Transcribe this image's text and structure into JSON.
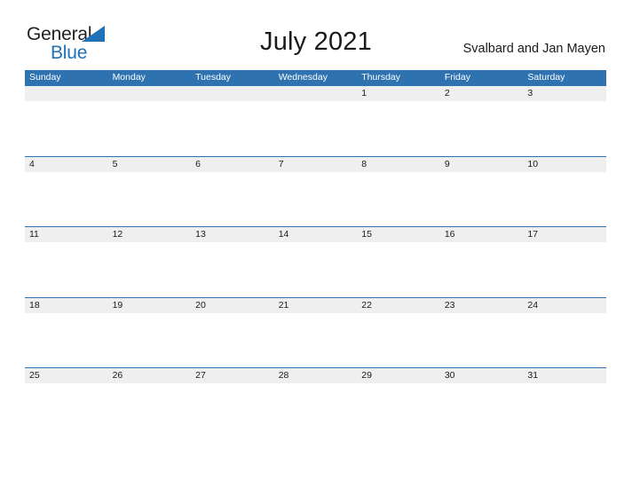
{
  "brand": {
    "line1": "General",
    "line2": "Blue",
    "triangle_icon": "brand-triangle-icon",
    "colors": {
      "line1": "#231f20",
      "line2": "#1f71b8",
      "triangle": "#1f71b8"
    }
  },
  "header": {
    "title": "July 2021",
    "region": "Svalbard and Jan Mayen"
  },
  "calendar": {
    "month": "July",
    "year": "2021",
    "weekday_headers": [
      "Sunday",
      "Monday",
      "Tuesday",
      "Wednesday",
      "Thursday",
      "Friday",
      "Saturday"
    ],
    "colors": {
      "header_background": "#2e72b0",
      "header_text": "#ffffff",
      "row_divider": "#2e72b0",
      "day_band_background": "#efefef",
      "day_text": "#1a1a1a",
      "cell_background": "#ffffff"
    },
    "weeks": [
      [
        "",
        "",
        "",
        "",
        "1",
        "2",
        "3"
      ],
      [
        "4",
        "5",
        "6",
        "7",
        "8",
        "9",
        "10"
      ],
      [
        "11",
        "12",
        "13",
        "14",
        "15",
        "16",
        "17"
      ],
      [
        "18",
        "19",
        "20",
        "21",
        "22",
        "23",
        "24"
      ],
      [
        "25",
        "26",
        "27",
        "28",
        "29",
        "30",
        "31"
      ]
    ]
  }
}
